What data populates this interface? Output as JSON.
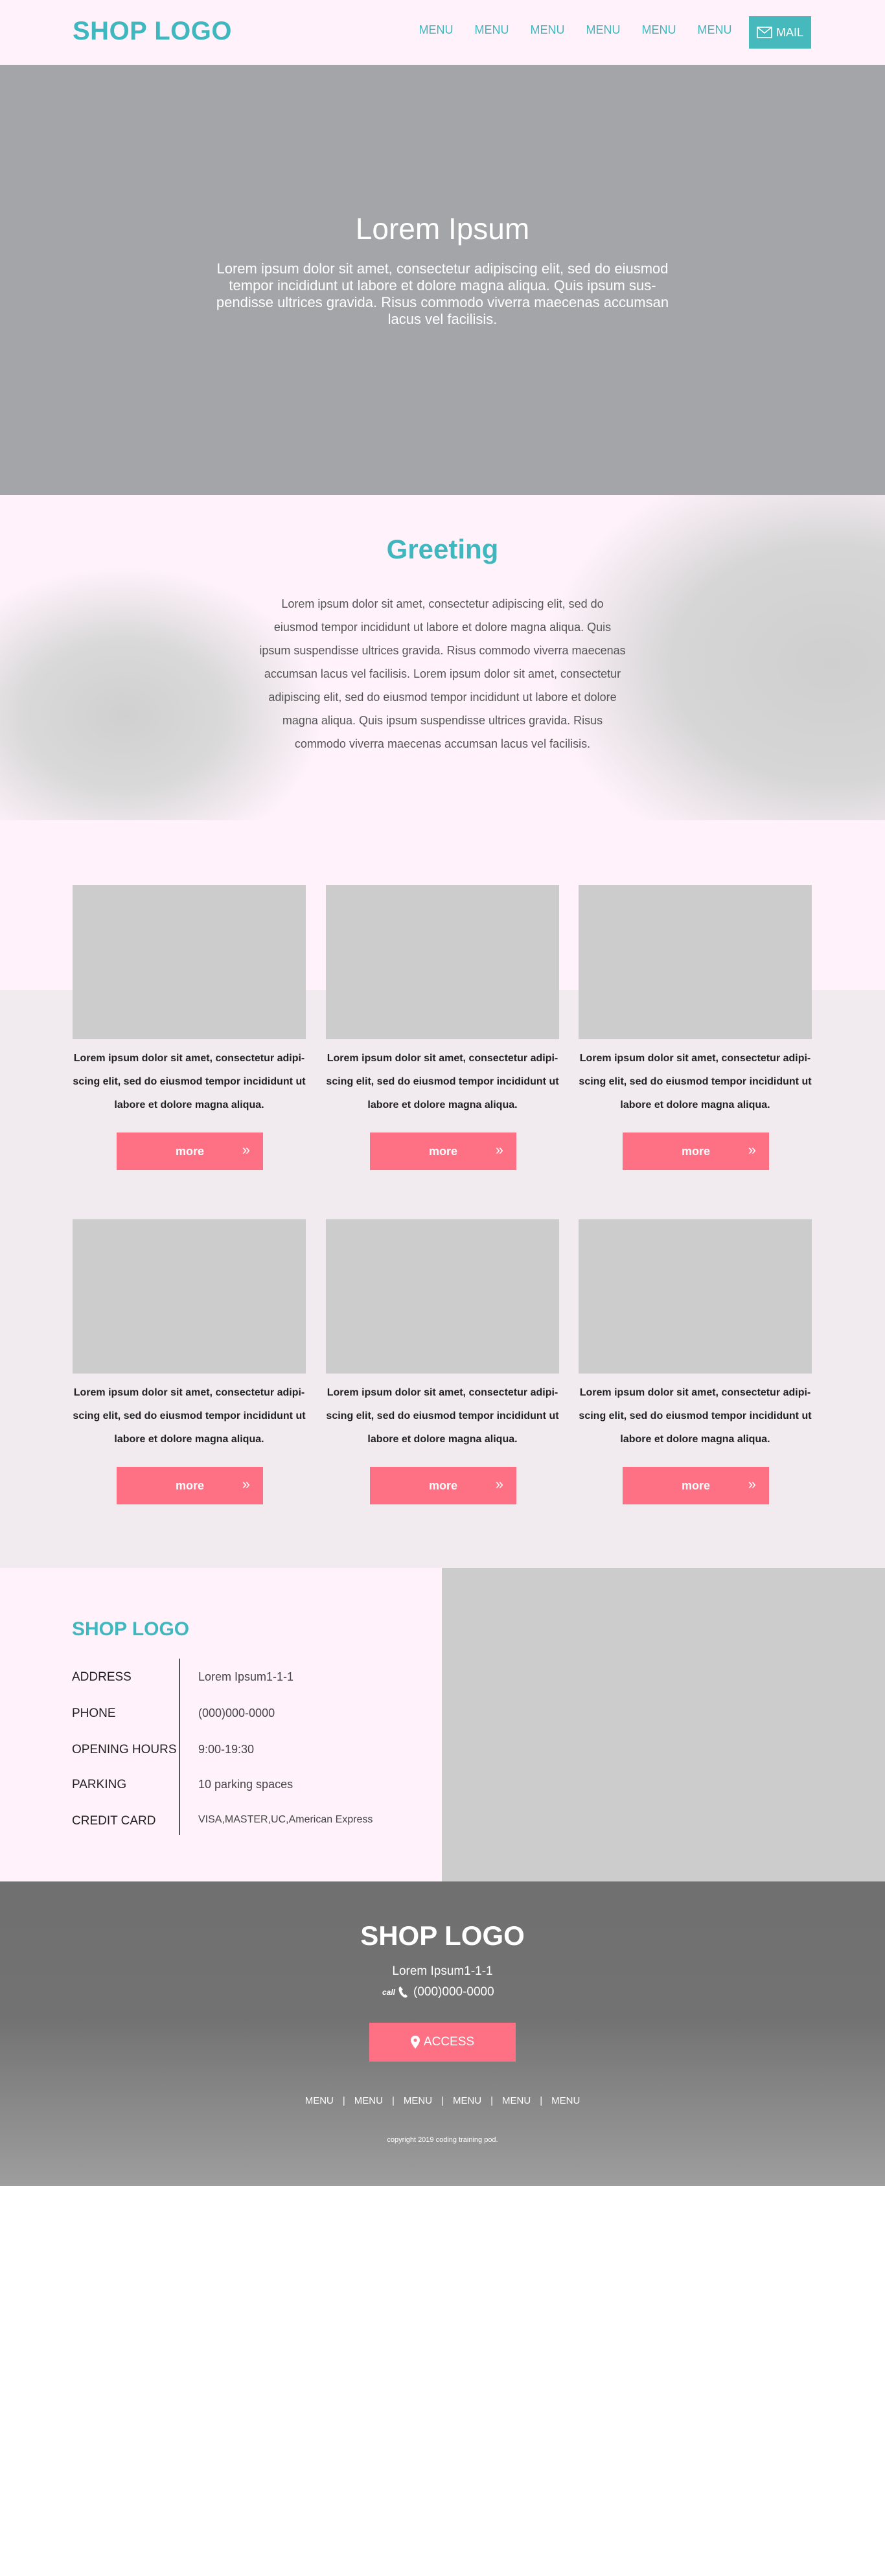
{
  "header": {
    "logo": "SHOP LOGO",
    "nav": [
      "MENU",
      "MENU",
      "MENU",
      "MENU",
      "MENU",
      "MENU"
    ],
    "mail_label": "MAIL"
  },
  "hero": {
    "title": "Lorem Ipsum",
    "text": "Lorem ipsum dolor sit amet, consectetur adipiscing elit, sed do eiusmod tempor incididunt ut labore et dolore magna aliqua. Quis ipsum sus-pendisse ultrices gravida. Risus commodo viverra maecenas accumsan lacus vel facilisis."
  },
  "greeting": {
    "title": "Greeting",
    "text": "Lorem ipsum dolor sit amet, consectetur adipiscing elit, sed do eiusmod tempor incididunt ut labore et dolore magna aliqua. Quis ipsum suspendisse ultrices gravida. Risus commodo viverra maecenas accumsan lacus vel facilisis. Lorem ipsum dolor sit amet, consectetur adipiscing elit, sed do eiusmod tempor incididunt ut labore et dolore magna aliqua. Quis ipsum suspendisse ultrices gravida. Risus commodo viverra maecenas accumsan lacus vel facilisis."
  },
  "cards": [
    {
      "text": "Lorem ipsum dolor sit amet, consectetur adipi-scing elit, sed do eiusmod tempor incididunt ut labore et dolore magna aliqua.",
      "button": "more"
    },
    {
      "text": "Lorem ipsum dolor sit amet, consectetur adipi-scing elit, sed do eiusmod tempor incididunt ut labore et dolore magna aliqua.",
      "button": "more"
    },
    {
      "text": "Lorem ipsum dolor sit amet, consectetur adipi-scing elit, sed do eiusmod tempor incididunt ut labore et dolore magna aliqua.",
      "button": "more"
    },
    {
      "text": "Lorem ipsum dolor sit amet, consectetur adipi-scing elit, sed do eiusmod tempor incididunt ut labore et dolore magna aliqua.",
      "button": "more"
    },
    {
      "text": "Lorem ipsum dolor sit amet, consectetur adipi-scing elit, sed do eiusmod tempor incididunt ut labore et dolore magna aliqua.",
      "button": "more"
    },
    {
      "text": "Lorem ipsum dolor sit amet, consectetur adipi-scing elit, sed do eiusmod tempor incididunt ut labore et dolore magna aliqua.",
      "button": "more"
    }
  ],
  "shop_info": {
    "logo": "SHOP LOGO",
    "rows": [
      {
        "label": "ADDRESS",
        "value": "Lorem Ipsum1-1-1"
      },
      {
        "label": "PHONE",
        "value": "(000)000-0000"
      },
      {
        "label": "OPENING HOURS",
        "value": "9:00-19:30"
      },
      {
        "label": "PARKING",
        "value": "10 parking spaces"
      },
      {
        "label": "CREDIT CARD",
        "value": "VISA,MASTER,UC,American Express"
      }
    ]
  },
  "footer": {
    "logo": "SHOP LOGO",
    "address": "Lorem Ipsum1-1-1",
    "call_label": "call",
    "phone": "(000)000-0000",
    "access_label": "ACCESS",
    "nav": [
      "MENU",
      "MENU",
      "MENU",
      "MENU",
      "MENU",
      "MENU"
    ],
    "copyright": "copyright 2019 coding training pod."
  },
  "colors": {
    "accent": "#3fb7bf",
    "button": "#fe7184",
    "pink_bg": "#fff2fb",
    "placeholder": "#cccccc"
  },
  "icons": [
    "mail-icon",
    "double-chevron-right-icon",
    "phone-icon",
    "map-pin-icon"
  ]
}
